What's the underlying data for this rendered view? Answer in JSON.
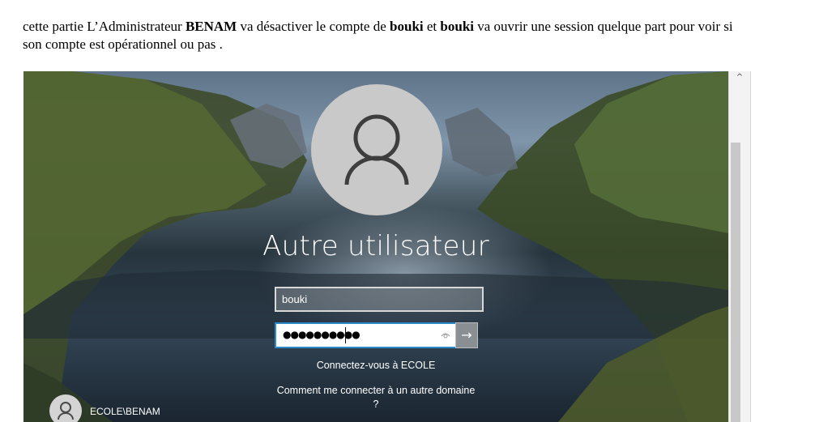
{
  "document": {
    "intro_segments": [
      "cette partie L’Administrateur ",
      "BENAM",
      " va désactiver le compte de ",
      "bouki",
      " et ",
      "bouki",
      " va ouvrir une session quelque part pour voir si son compte est opérationnel ou pas ."
    ]
  },
  "login_screen": {
    "title": "Autre utilisateur",
    "username_value": "bouki",
    "password_masked": "●●●●●●●●●●",
    "reveal_icon": "eye-icon",
    "submit_icon": "arrow-right-icon",
    "submit_symbol": "→",
    "domain_link": "Connectez-vous à ECOLE",
    "other_domain_link": "Comment me connecter à un autre domaine ?",
    "switch_user_label": "ECOLE\\BENAM"
  },
  "scrollbar": {
    "up_symbol": "^"
  }
}
